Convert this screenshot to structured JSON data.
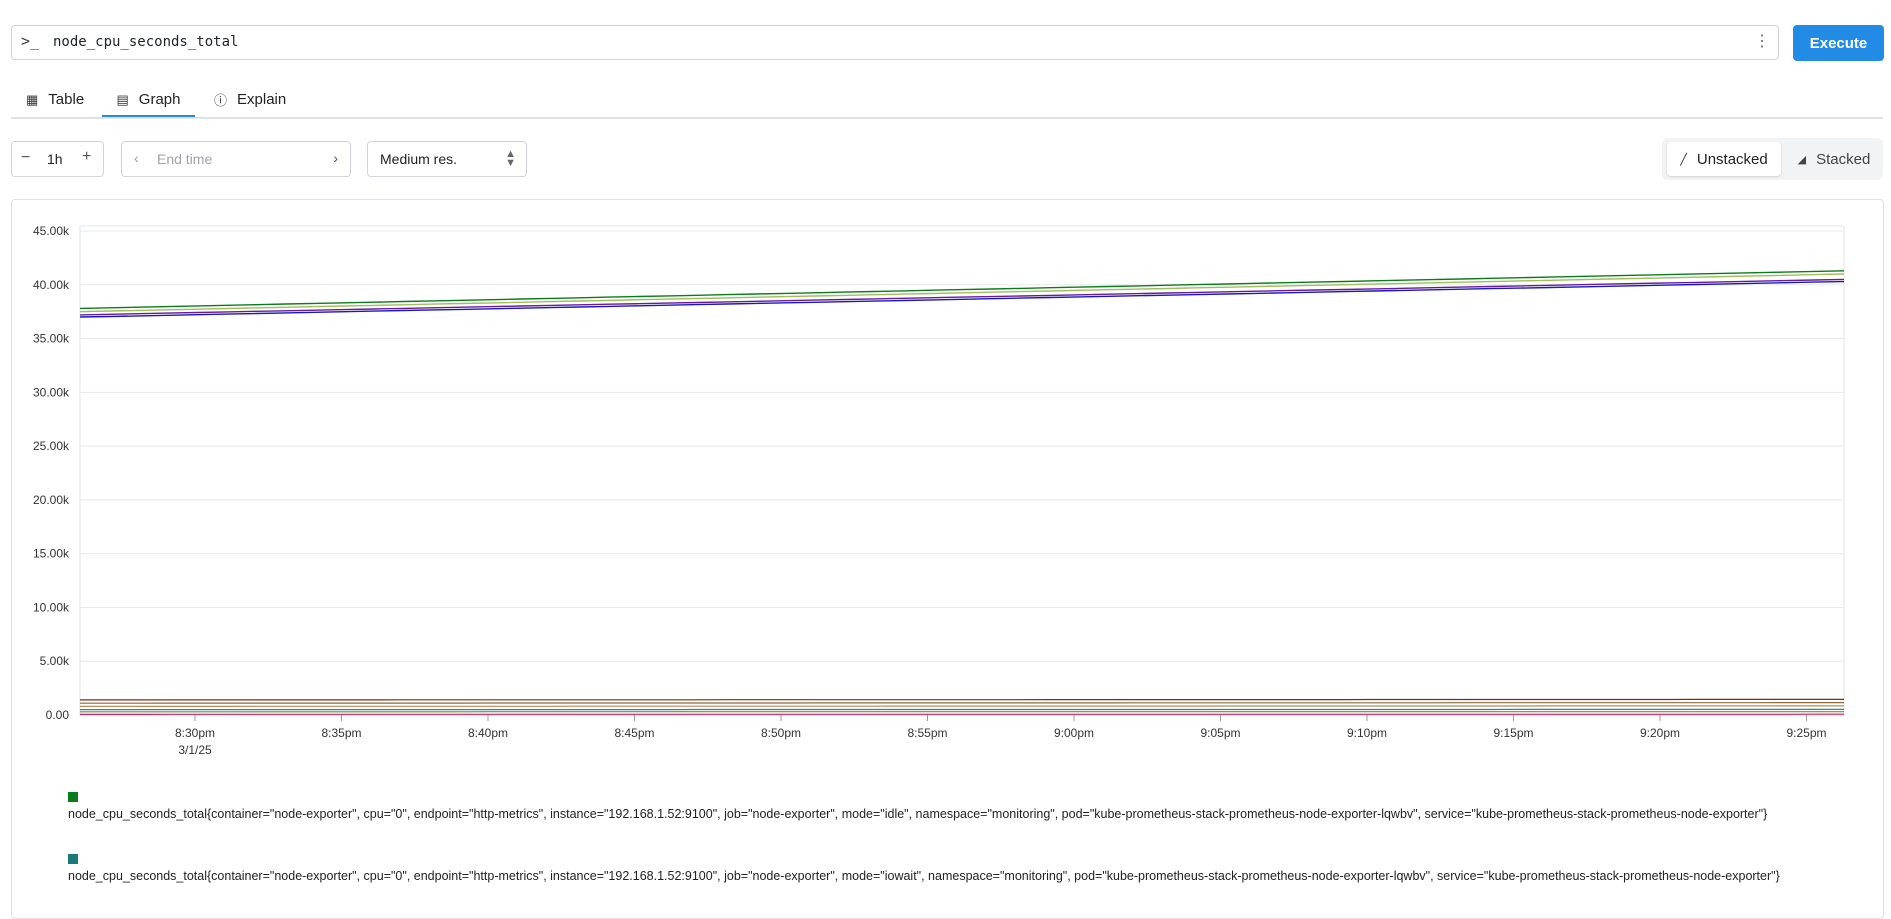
{
  "query": {
    "prompt_icon": "terminal-prompt-icon",
    "expression": "node_cpu_seconds_total",
    "menu_icon": "kebab-menu-icon",
    "execute_label": "Execute"
  },
  "tabs": [
    {
      "label": "Table",
      "icon": "table-icon"
    },
    {
      "label": "Graph",
      "icon": "graph-icon",
      "active": true
    },
    {
      "label": "Explain",
      "icon": "info-icon"
    }
  ],
  "controls": {
    "range": "1h",
    "end_time_placeholder": "End time",
    "resolution": "Medium res.",
    "unstacked_label": "Unstacked",
    "stacked_label": "Stacked",
    "active_mode": "Unstacked"
  },
  "colors": {
    "accent": "#228be6"
  },
  "chart_data": {
    "type": "line",
    "y_ticks": [
      "45.00k",
      "40.00k",
      "35.00k",
      "30.00k",
      "25.00k",
      "20.00k",
      "15.00k",
      "10.00k",
      "5.00k",
      "0.00"
    ],
    "ylim": [
      0,
      45000
    ],
    "x_ticks": [
      "8:30pm",
      "8:35pm",
      "8:40pm",
      "8:45pm",
      "8:50pm",
      "8:55pm",
      "9:00pm",
      "9:05pm",
      "9:10pm",
      "9:15pm",
      "9:20pm",
      "9:25pm"
    ],
    "x_date_label": "3/1/25",
    "grid": true,
    "series": [
      {
        "color": "#0a7d1a",
        "start": 37800,
        "end": 41300
      },
      {
        "color": "#9fbf5c",
        "start": 37500,
        "end": 41000
      },
      {
        "color": "#6a1b9a",
        "start": 37200,
        "end": 40500
      },
      {
        "color": "#1a1ab8",
        "start": 37000,
        "end": 40300
      },
      {
        "color": "#7a2e12",
        "start": 1400,
        "end": 1450
      },
      {
        "color": "#8a6a3a",
        "start": 1100,
        "end": 1150
      },
      {
        "color": "#b58a5a",
        "start": 800,
        "end": 850
      },
      {
        "color": "#2a8a8a",
        "start": 500,
        "end": 520
      },
      {
        "color": "#5a9a3a",
        "start": 300,
        "end": 310
      },
      {
        "color": "#d81b60",
        "start": 60,
        "end": 70
      }
    ]
  },
  "legend": [
    {
      "color": "#0a7d1a",
      "text": "node_cpu_seconds_total{container=\"node-exporter\", cpu=\"0\", endpoint=\"http-metrics\", instance=\"192.168.1.52:9100\", job=\"node-exporter\", mode=\"idle\", namespace=\"monitoring\", pod=\"kube-prometheus-stack-prometheus-node-exporter-lqwbv\", service=\"kube-prometheus-stack-prometheus-node-exporter\"}"
    },
    {
      "color": "#1a7a7a",
      "text": "node_cpu_seconds_total{container=\"node-exporter\", cpu=\"0\", endpoint=\"http-metrics\", instance=\"192.168.1.52:9100\", job=\"node-exporter\", mode=\"iowait\", namespace=\"monitoring\", pod=\"kube-prometheus-stack-prometheus-node-exporter-lqwbv\", service=\"kube-prometheus-stack-prometheus-node-exporter\"}"
    }
  ]
}
